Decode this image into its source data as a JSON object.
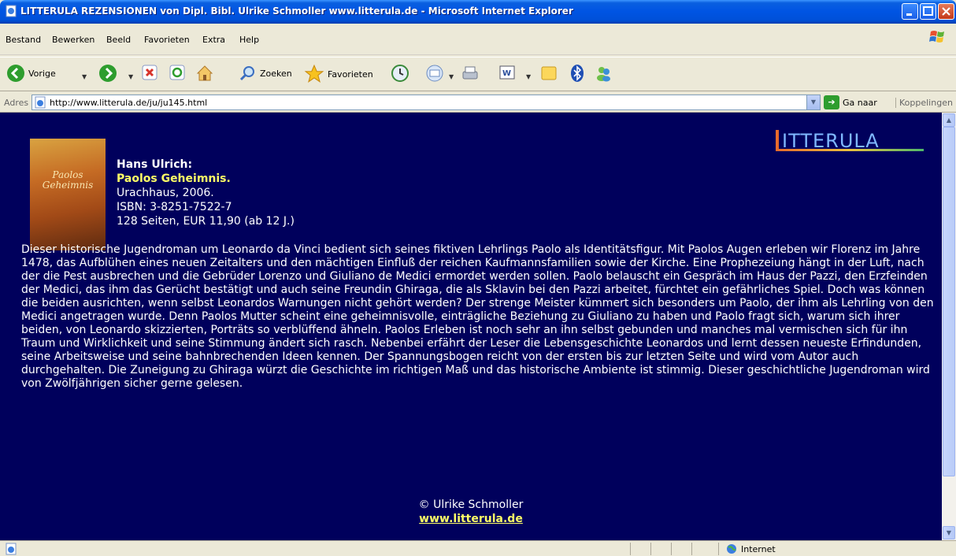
{
  "window": {
    "title": "LITTERULA REZENSIONEN von Dipl. Bibl. Ulrike Schmoller www.litterula.de - Microsoft Internet Explorer"
  },
  "menu": [
    "Bestand",
    "Bewerken",
    "Beeld",
    "Favorieten",
    "Extra",
    "Help"
  ],
  "toolbar": {
    "back": "Vorige",
    "search": "Zoeken",
    "favorites": "Favorieten"
  },
  "address": {
    "label": "Adres",
    "url": "http://www.litterula.de/ju/ju145.html",
    "go": "Ga naar",
    "links": "Koppelingen"
  },
  "logo": {
    "text": "LITTERULA"
  },
  "book": {
    "author": "Hans Ulrich:",
    "title": "Paolos Geheimnis.",
    "publisher": "Urachhaus, 2006.",
    "isbn": "ISBN: 3-8251-7522-7",
    "pages": "128 Seiten, EUR 11,90 (ab 12 J.)",
    "cover_title": "Paolos Geheimnis"
  },
  "review": "Dieser historische Jugendroman um Leonardo da Vinci bedient sich seines fiktiven Lehrlings Paolo als Identitätsfigur. Mit Paolos Augen erleben wir Florenz im Jahre 1478, das Aufblühen eines neuen Zeitalters und den mächtigen Einfluß der reichen Kaufmannsfamilien sowie der Kirche. Eine Prophezeiung hängt in der Luft, nach der die Pest ausbrechen und die Gebrüder Lorenzo und Giuliano de Medici ermordet werden sollen. Paolo belauscht ein Gespräch im Haus der Pazzi, den Erzfeinden der Medici, das ihm das Gerücht bestätigt und auch seine Freundin Ghiraga, die als Sklavin bei den Pazzi arbeitet, fürchtet ein gefährliches Spiel. Doch was können die beiden ausrichten, wenn selbst Leonardos Warnungen nicht gehört werden? Der strenge Meister kümmert sich besonders um Paolo, der ihm als Lehrling von den Medici angetragen wurde. Denn Paolos Mutter scheint eine geheimnisvolle, einträgliche Beziehung zu Giuliano zu haben und Paolo fragt sich, warum sich ihrer beiden, von Leonardo skizzierten, Porträts so verblüffend ähneln. Paolos Erleben ist noch sehr an ihn selbst gebunden und manches mal vermischen sich für ihn Traum und Wirklichkeit und seine Stimmung ändert sich rasch. Nebenbei erfährt der Leser die Lebensgeschichte Leonardos und lernt dessen neueste Erfindunden, seine Arbeitsweise und seine bahnbrechenden Ideen kennen. Der Spannungsbogen reicht von der ersten bis zur letzten Seite und wird vom Autor auch durchgehalten. Die Zuneigung zu Ghiraga würzt die Geschichte im richtigen Maß und das historische Ambiente ist stimmig. Dieser geschichtliche Jugendroman wird von Zwölfjährigen sicher gerne gelesen.",
  "footer": {
    "copyright": "© Ulrike Schmoller",
    "link": "www.litterula.de"
  },
  "status": {
    "zone": "Internet"
  },
  "colors": {
    "page_bg": "#00005C",
    "highlight": "#FFFF66",
    "titlebar": "#0054E3"
  }
}
